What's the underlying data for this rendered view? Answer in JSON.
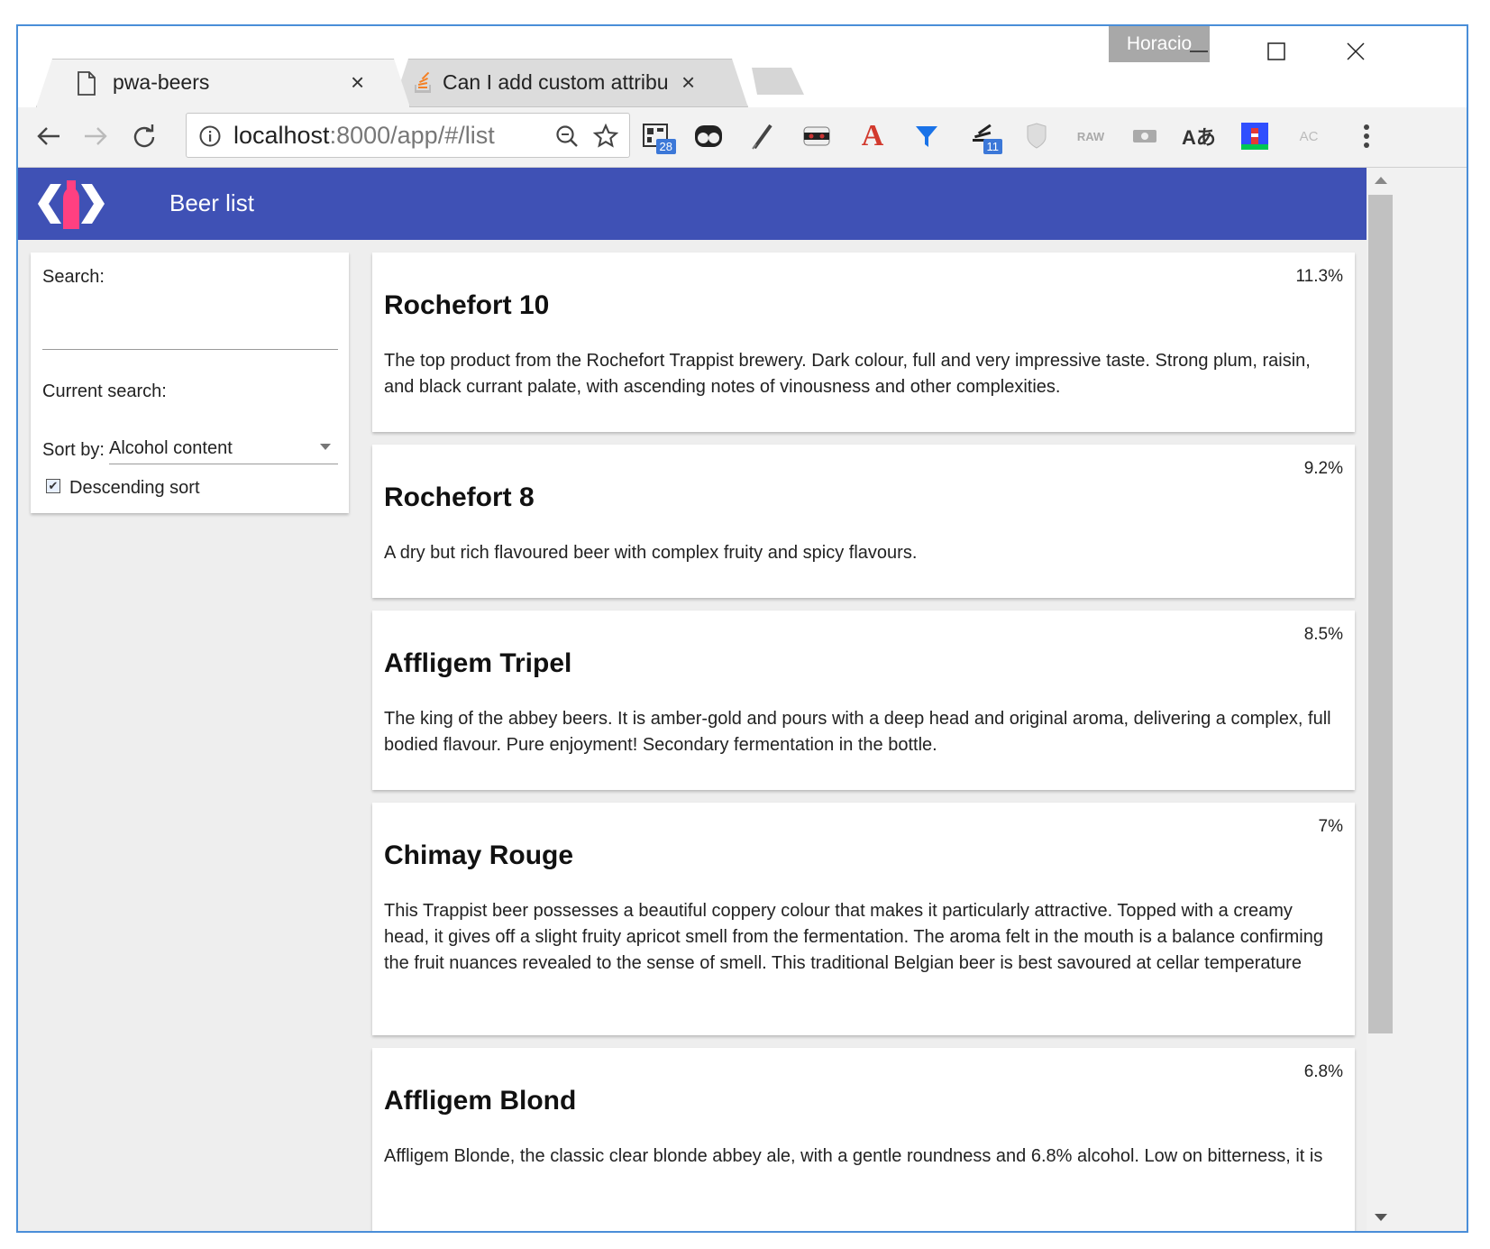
{
  "browser": {
    "profile_name": "Horacio",
    "tabs": [
      {
        "title": "pwa-beers",
        "close": "×"
      },
      {
        "title": "Can I add custom attribu",
        "close": "×"
      }
    ],
    "url_host": "localhost",
    "url_rest": ":8000/app/#/list",
    "extensions": [
      {
        "icon": "qr-icon",
        "badge": "28"
      },
      {
        "icon": "ghostery-icon",
        "badge": ""
      },
      {
        "icon": "pen-icon",
        "badge": ""
      },
      {
        "icon": "mask-icon",
        "badge": ""
      },
      {
        "icon": "font-a-icon",
        "badge": ""
      },
      {
        "icon": "funnel-icon",
        "badge": ""
      },
      {
        "icon": "stackexchange-icon",
        "badge": "11"
      },
      {
        "icon": "shield-icon",
        "badge": ""
      },
      {
        "icon": "raw-icon",
        "badge": ""
      },
      {
        "icon": "camera-icon",
        "badge": ""
      },
      {
        "icon": "translate-icon",
        "badge": ""
      },
      {
        "icon": "lighthouse-icon",
        "badge": ""
      },
      {
        "icon": "ac-icon",
        "badge": ""
      }
    ],
    "accent": "#4a8ed8"
  },
  "app": {
    "title": "Beer list",
    "bar_color": "#3f51b5",
    "logo_color": "#ff4081"
  },
  "filters": {
    "search_label": "Search:",
    "search_value": "",
    "current_search_label": "Current search:",
    "current_search_value": "",
    "sort_label": "Sort by:",
    "sort_value": "Alcohol content",
    "descending_label": "Descending sort",
    "descending_checked": true
  },
  "beers": [
    {
      "name": "Rochefort 10",
      "alcohol": "11.3%",
      "description": "The top product from the Rochefort Trappist brewery. Dark colour, full and very impressive taste. Strong plum, raisin, and black currant palate, with ascending notes of vinousness and other complexities."
    },
    {
      "name": "Rochefort 8",
      "alcohol": "9.2%",
      "description": "A dry but rich flavoured beer with complex fruity and spicy flavours."
    },
    {
      "name": "Affligem Tripel",
      "alcohol": "8.5%",
      "description": "The king of the abbey beers. It is amber-gold and pours with a deep head and original aroma, delivering a complex, full bodied flavour. Pure enjoyment! Secondary fermentation in the bottle."
    },
    {
      "name": "Chimay Rouge",
      "alcohol": "7%",
      "description": "This Trappist beer possesses a beautiful coppery colour that makes it particularly attractive. Topped with a creamy head, it gives off a slight fruity apricot smell from the fermentation. The aroma felt in the mouth is a balance confirming the fruit nuances revealed to the sense of smell. This traditional Belgian beer is best savoured at cellar temperature"
    },
    {
      "name": "Affligem Blond",
      "alcohol": "6.8%",
      "description": "Affligem Blonde, the classic clear blonde abbey ale, with a gentle roundness and 6.8% alcohol. Low on bitterness, it is"
    }
  ]
}
